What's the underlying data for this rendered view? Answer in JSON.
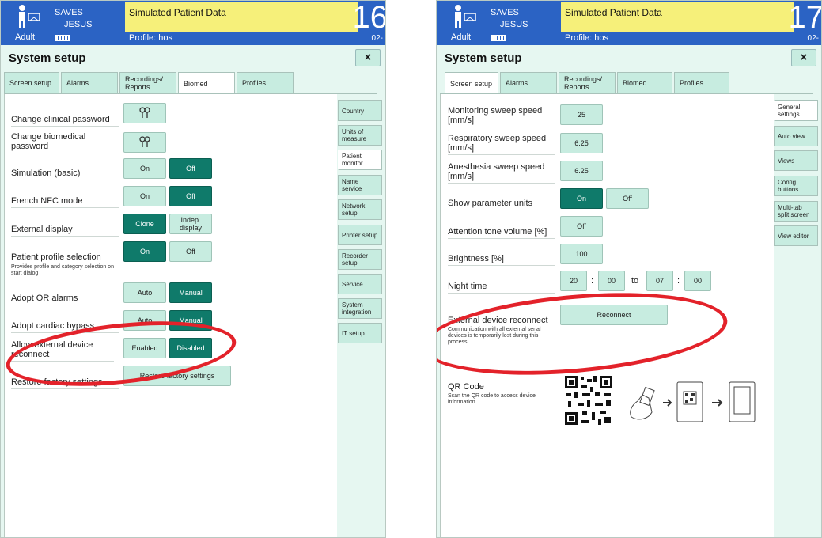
{
  "common": {
    "patient_line1": "SAVES",
    "patient_line2": "JESUS",
    "patient_type": "Adult",
    "sim_banner": "Simulated Patient Data",
    "profile": "Profile: hos",
    "title": "System setup",
    "close_symbol": "×"
  },
  "left": {
    "big_number": "16",
    "small_number": "02-",
    "tabs": [
      {
        "label": "Screen setup"
      },
      {
        "label": "Alarms"
      },
      {
        "label": "Recordings/ Reports"
      },
      {
        "label": "Biomed",
        "active": true
      },
      {
        "label": "Profiles"
      }
    ],
    "side_tabs": [
      {
        "label": "Country"
      },
      {
        "label": "Units of measure"
      },
      {
        "label": "Patient monitor",
        "active": true
      },
      {
        "label": "Name service"
      },
      {
        "label": "Network setup"
      },
      {
        "label": "Printer setup"
      },
      {
        "label": "Recorder setup"
      },
      {
        "label": "Service"
      },
      {
        "label": "System integration"
      },
      {
        "label": "IT setup"
      }
    ],
    "rows": {
      "change_clinical_password": "Change clinical password",
      "change_biomedical_password": "Change biomedical password",
      "simulation_basic": {
        "label": "Simulation (basic)",
        "on": "On",
        "off": "Off",
        "selected": "Off"
      },
      "french_nfc": {
        "label": "French NFC mode",
        "on": "On",
        "off": "Off",
        "selected": "Off"
      },
      "external_display": {
        "label": "External display",
        "clone": "Clone",
        "indep": "Indep. display",
        "selected": "Clone"
      },
      "patient_profile": {
        "label": "Patient profile selection",
        "sub": "Provides profile and category selection on start dialog",
        "on": "On",
        "off": "Off",
        "selected": "On"
      },
      "adopt_or_alarms": {
        "label": "Adopt OR alarms",
        "auto": "Auto",
        "manual": "Manual",
        "selected": "Manual"
      },
      "adopt_cardiac_bypass": {
        "label": "Adopt cardiac bypass",
        "auto": "Auto",
        "manual": "Manual",
        "selected": "Manual"
      },
      "allow_ext_reconnect": {
        "label": "Allow external device reconnect",
        "enabled": "Enabled",
        "disabled": "Disabled",
        "selected": "Disabled"
      },
      "restore_factory": {
        "label": "Restore factory settings",
        "button": "Restore factory settings"
      }
    },
    "highlight_color": "#e3222a"
  },
  "right": {
    "big_number": "17",
    "small_number": "02-",
    "tabs": [
      {
        "label": "Screen setup",
        "active": true
      },
      {
        "label": "Alarms"
      },
      {
        "label": "Recordings/ Reports"
      },
      {
        "label": "Biomed"
      },
      {
        "label": "Profiles"
      }
    ],
    "side_tabs": [
      {
        "label": "General settings",
        "active": true
      },
      {
        "label": "Auto view"
      },
      {
        "label": "Views"
      },
      {
        "label": "Config. buttons"
      },
      {
        "label": "Multi-tab split screen"
      },
      {
        "label": "View editor"
      }
    ],
    "rows": {
      "monitoring_sweep": {
        "label": "Monitoring sweep speed [mm/s]",
        "value": "25"
      },
      "respiratory_sweep": {
        "label": "Respiratory sweep speed [mm/s]",
        "value": "6.25"
      },
      "anesthesia_sweep": {
        "label": "Anesthesia sweep speed [mm/s]",
        "value": "6.25"
      },
      "show_units": {
        "label": "Show parameter units",
        "on": "On",
        "off": "Off",
        "selected": "On"
      },
      "attention_tone": {
        "label": "Attention tone volume [%]",
        "value": "Off"
      },
      "brightness": {
        "label": "Brightness [%]",
        "value": "100"
      },
      "night_time": {
        "label": "Night time",
        "from_h": "20",
        "from_m": "00",
        "to": "to",
        "to_h": "07",
        "to_m": "00",
        "colon": ":"
      },
      "ext_reconnect": {
        "label": "External device reconnect",
        "sub": "Communication with all external serial devices is temporarily lost during this process.",
        "button": "Reconnect"
      },
      "qr": {
        "label": "QR Code",
        "sub": "Scan the QR code to access device information."
      }
    }
  },
  "colors": {
    "header_blue": "#2b63c4",
    "banner_yellow": "#f6f07a",
    "panel_bg": "#e6f7f1",
    "button_mint": "#c7ece0",
    "selected_teal": "#0f7a6a"
  }
}
